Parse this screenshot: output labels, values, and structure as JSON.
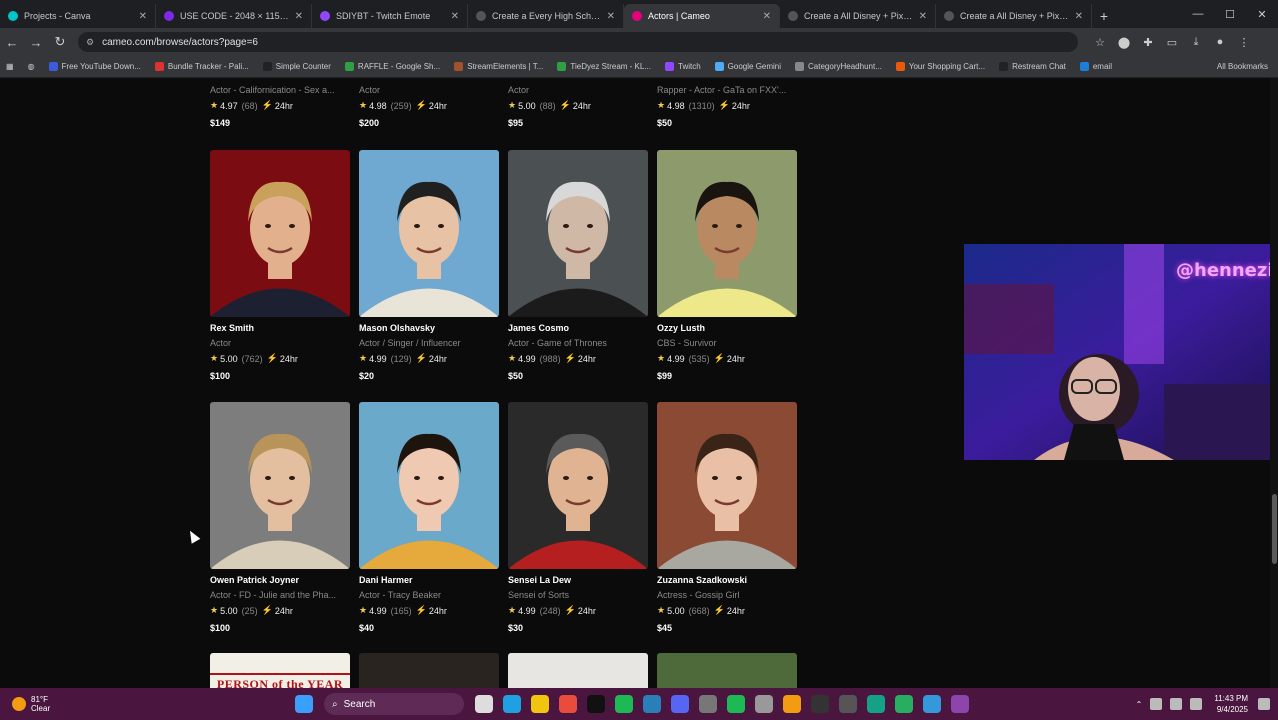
{
  "browser": {
    "tabs": [
      {
        "label": "Projects - Canva",
        "color": "#00c4cc",
        "active": false
      },
      {
        "label": "USE CODE - 2048 × 1152px",
        "color": "#7d2ae8",
        "active": false
      },
      {
        "label": "SDIYBT - Twitch Emote",
        "color": "#9146ff",
        "active": false
      },
      {
        "label": "Create a Every High School Mu",
        "color": "#555555",
        "active": false
      },
      {
        "label": "Actors | Cameo",
        "color": "#e6007e",
        "active": true
      },
      {
        "label": "Create a All Disney + Pixar Film",
        "color": "#555555",
        "active": false
      },
      {
        "label": "Create a All Disney + Pixar Film",
        "color": "#555555",
        "active": false
      }
    ],
    "url": "cameo.com/browse/actors?page=6",
    "bookmarks": [
      {
        "label": "Free YouTube Down...",
        "color": "#3b5bdb"
      },
      {
        "label": "Bundle Tracker - Pali...",
        "color": "#e03131"
      },
      {
        "label": "Simple Counter",
        "color": "#222222"
      },
      {
        "label": "RAFFLE - Google Sh...",
        "color": "#2f9e44"
      },
      {
        "label": "StreamElements | T...",
        "color": "#a0522d"
      },
      {
        "label": "TieDyez Stream - KL...",
        "color": "#2f9e44"
      },
      {
        "label": "Twitch",
        "color": "#9146ff"
      },
      {
        "label": "Google Gemini",
        "color": "#4dabf7"
      },
      {
        "label": "CategoryHeadhunt...",
        "color": "#888888"
      },
      {
        "label": "Your Shopping Cart...",
        "color": "#e8590c"
      },
      {
        "label": "Restream Chat",
        "color": "#222222"
      },
      {
        "label": "email",
        "color": "#1c7ed6"
      }
    ],
    "all_bookmarks": "All Bookmarks"
  },
  "top_row": [
    {
      "role": "Actor - Californication - Sex a...",
      "rating": "4.97",
      "count": "(68)",
      "speed": "24hr",
      "price": "$149"
    },
    {
      "role": "Actor",
      "rating": "4.98",
      "count": "(259)",
      "speed": "24hr",
      "price": "$200"
    },
    {
      "role": "Actor",
      "rating": "5.00",
      "count": "(88)",
      "speed": "24hr",
      "price": "$95"
    },
    {
      "role": "Rapper - Actor - GaTa on FXX'...",
      "rating": "4.98",
      "count": "(1310)",
      "speed": "24hr",
      "price": "$50"
    }
  ],
  "talent": [
    {
      "name": "Rex Smith",
      "role": "Actor",
      "rating": "5.00",
      "count": "(762)",
      "speed": "24hr",
      "price": "$100",
      "bg": "#7a0c12",
      "skin": "#e2b08c",
      "hair": "#c9a15a",
      "shirt": "#1d2030"
    },
    {
      "name": "Mason Olshavsky",
      "role": "Actor / Singer / Influencer",
      "rating": "4.99",
      "count": "(129)",
      "speed": "24hr",
      "price": "$20",
      "bg": "#6fa9d1",
      "skin": "#e8c2a4",
      "hair": "#202020",
      "shirt": "#e9e4d8"
    },
    {
      "name": "James Cosmo",
      "role": "Actor - Game of Thrones",
      "rating": "4.99",
      "count": "(988)",
      "speed": "24hr",
      "price": "$50",
      "bg": "#4b5052",
      "skin": "#cfb8a6",
      "hair": "#d8d8d8",
      "shirt": "#1b1b1b"
    },
    {
      "name": "Ozzy Lusth",
      "role": "CBS - Survivor",
      "rating": "4.99",
      "count": "(535)",
      "speed": "24hr",
      "price": "$99",
      "bg": "#8c9a6c",
      "skin": "#b98a62",
      "hair": "#1a1410",
      "shirt": "#ede98a"
    },
    {
      "name": "Owen Patrick Joyner",
      "role": "Actor - FD - Julie and the Pha...",
      "rating": "5.00",
      "count": "(25)",
      "speed": "24hr",
      "price": "$100",
      "bg": "#7d7d7d",
      "skin": "#e3bf9f",
      "hair": "#b8935a",
      "shirt": "#d8cdb8"
    },
    {
      "name": "Dani Harmer",
      "role": "Actor - Tracy Beaker",
      "rating": "4.99",
      "count": "(165)",
      "speed": "24hr",
      "price": "$40",
      "bg": "#6aa9c9",
      "skin": "#f0c9b2",
      "hair": "#1e140e",
      "shirt": "#e6a93c"
    },
    {
      "name": "Sensei La Dew",
      "role": "Sensei of Sorts",
      "rating": "4.99",
      "count": "(248)",
      "speed": "24hr",
      "price": "$30",
      "bg": "#2a2a2a",
      "skin": "#e0b392",
      "hair": "#5a5a5a",
      "shirt": "#b51f1f"
    },
    {
      "name": "Zuzanna Szadkowski",
      "role": "Actress - Gossip Girl",
      "rating": "5.00",
      "count": "(668)",
      "speed": "24hr",
      "price": "$45",
      "bg": "#8a4a34",
      "skin": "#e9c0a6",
      "hair": "#3a2418",
      "shirt": "#a8a8a0"
    }
  ],
  "bottom_row": [
    {
      "banner": "PERSON of the YEAR",
      "bg": "#f2efe6"
    },
    {
      "banner": "",
      "bg": "#2a2420"
    },
    {
      "banner": "",
      "bg": "#e8e6e2"
    },
    {
      "banner": "",
      "bg": "#4f6a3a"
    }
  ],
  "stream_overlay": {
    "handle": "@henneziel"
  },
  "taskbar": {
    "weather_temp": "81°F",
    "weather_desc": "Clear",
    "search_label": "Search",
    "time": "11:43 PM",
    "date": "9/4/2025"
  }
}
